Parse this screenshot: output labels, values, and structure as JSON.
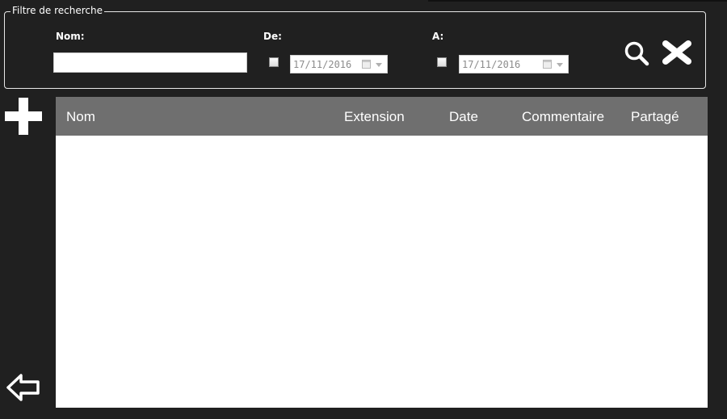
{
  "filter": {
    "legend": "Filtre de recherche",
    "name_label": "Nom:",
    "name_value": "",
    "from_label": "De:",
    "from_date": "17/11/2016",
    "to_label": "A:",
    "to_date": "17/11/2016"
  },
  "icons": {
    "search": "search-icon",
    "clear": "close-icon",
    "add": "plus-icon",
    "back": "arrow-left-icon"
  },
  "table": {
    "columns": [
      "Nom",
      "Extension",
      "Date",
      "Commentaire",
      "Partagé"
    ],
    "rows": []
  },
  "colors": {
    "background": "#202020",
    "header": "#6f6f6f",
    "table_body": "#ffffff"
  }
}
